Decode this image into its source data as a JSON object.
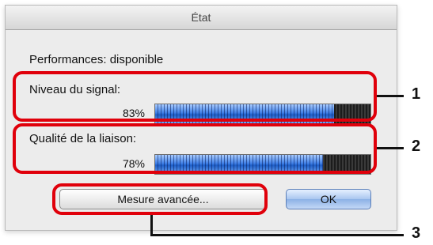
{
  "window": {
    "title": "État"
  },
  "status": {
    "text": "Performances: disponible"
  },
  "signal": {
    "label": "Niveau du signal:",
    "percent_text": "83%",
    "level": 0.83
  },
  "link": {
    "label": "Qualité de la liaison:",
    "percent_text": "78%",
    "level": 0.78
  },
  "buttons": {
    "advanced_label": "Mesure avancée...",
    "ok_label": "OK"
  },
  "callouts": [
    "1",
    "2",
    "3"
  ],
  "colors": {
    "callout": "#e0000b",
    "meter_fill": "#3d7ee8",
    "meter_empty": "#2a2a2a"
  }
}
